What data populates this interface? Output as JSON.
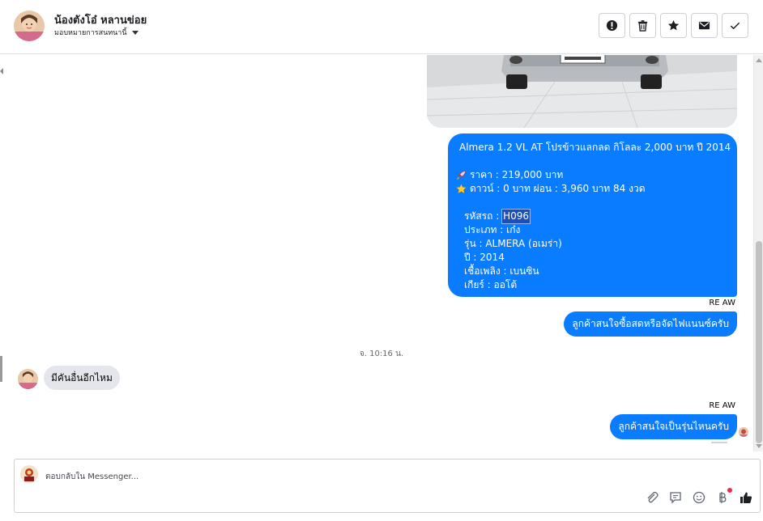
{
  "header": {
    "name": "น้องตังโอ๋ หลานข่อย",
    "assign_label": "มอบหมายการสนทนานี้",
    "actions": [
      "report",
      "delete",
      "star",
      "email",
      "done"
    ]
  },
  "messages": {
    "car_listing": {
      "title": "Almera 1.2 VL AT โปรข้าวแลกลด กิโลละ 2,000 บาท ปี 2014",
      "price": "ราคา : 219,000 บาท",
      "down": "ดาวน์ : 0 บาท ผ่อน : 3,960 บาท 84 งวด",
      "code_label": "รหัสรถ : ",
      "code_value": "H096",
      "type": "ประเภท : เก๋ง",
      "model": "รุ่น : ALMERA (อเมร่า)",
      "year": "ปี : 2014",
      "fuel": "เชื้อเพลิง : เบนซิน",
      "gear": "เกียร์ : ออโต้"
    },
    "sender_1": "RE AW",
    "reply_1": "ลูกค้าสนใจซื้อสดหรือจัดไฟแนนซ์ครับ",
    "timestamp": "จ. 10:16 น.",
    "incoming": "มีคันอื่นอีกไหม",
    "sender_2": "RE AW",
    "reply_2": "ลูกค้าสนใจเป็นรุ่นไหนครับ"
  },
  "composer": {
    "placeholder": "ตอบกลับใน Messenger..."
  },
  "colors": {
    "outgoing_bubble": "#0a7cff",
    "incoming_bubble": "#e4e6eb",
    "notification_dot": "#f02849"
  },
  "icons": [
    "report-icon",
    "trash-icon",
    "star-icon",
    "email-icon",
    "check-icon",
    "car-emoji",
    "rocket-emoji",
    "star-emoji",
    "paperclip-icon",
    "saved-reply-icon",
    "emoji-icon",
    "baht-icon",
    "like-icon"
  ]
}
